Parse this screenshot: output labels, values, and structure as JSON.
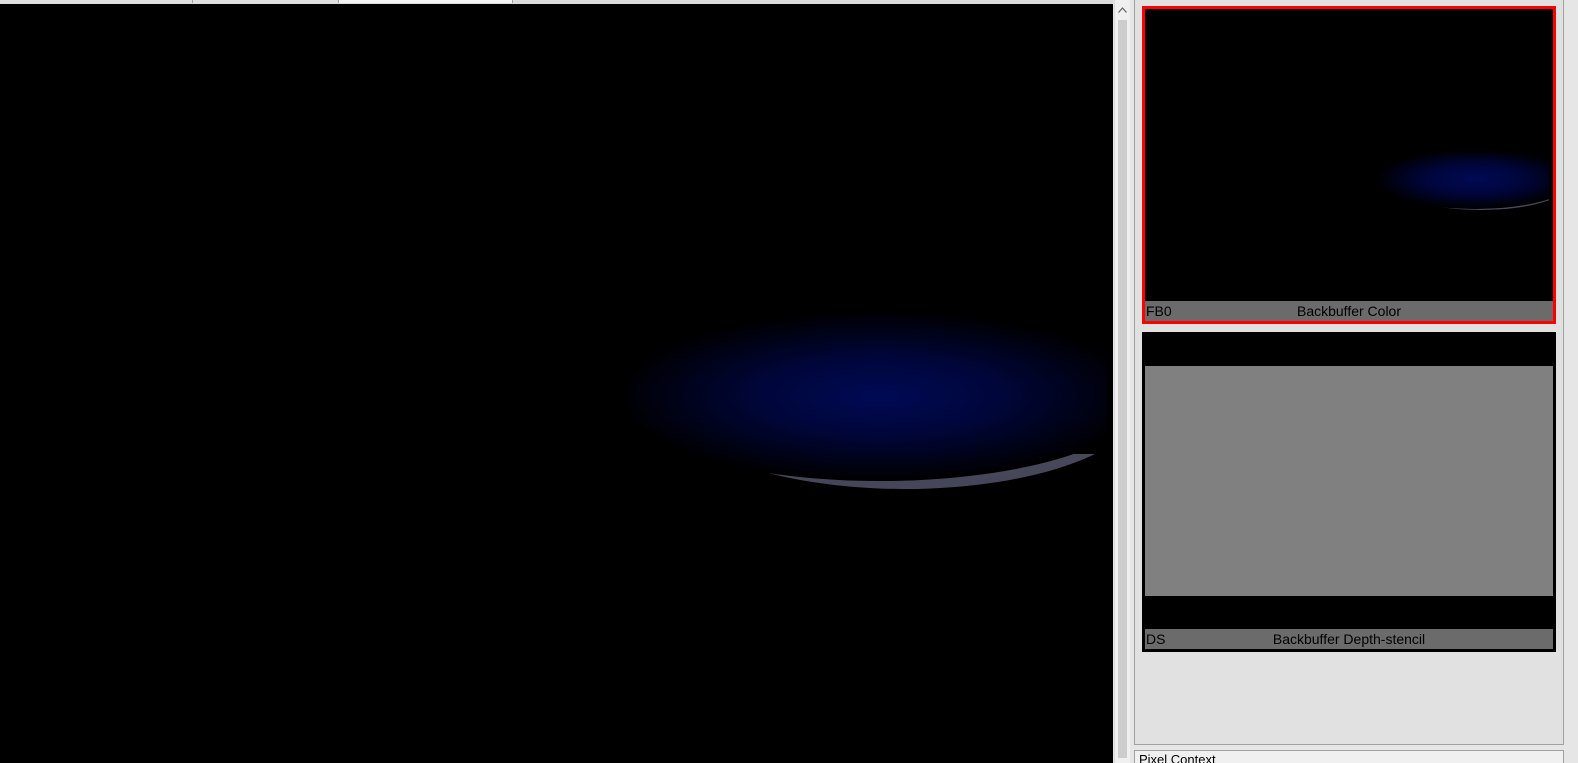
{
  "tabs": [
    {
      "label": ""
    },
    {
      "label": ""
    },
    {
      "label": ""
    }
  ],
  "viewport": {
    "background": "#000000",
    "object_color": "#000a55",
    "object_rim_color": "#4a4a5a"
  },
  "scrollbar": {
    "arrow_icon": "chevron-up-icon"
  },
  "thumbnails": [
    {
      "slot": "FB0",
      "name": "Backbuffer Color",
      "selected": true,
      "border_color": "#ff0000"
    },
    {
      "slot": "DS",
      "name": "Backbuffer Depth-stencil",
      "selected": false,
      "fill_color": "#808080"
    }
  ],
  "bottom_panel": {
    "title": "Pixel Context"
  }
}
